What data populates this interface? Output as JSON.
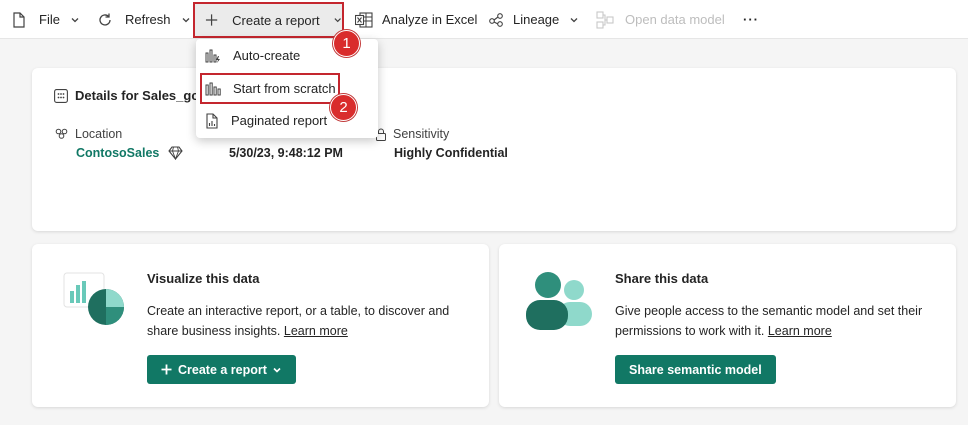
{
  "toolbar": {
    "file_label": "File",
    "refresh_label": "Refresh",
    "create_report_label": "Create a report",
    "analyze_excel_label": "Analyze in Excel",
    "lineage_label": "Lineage",
    "open_data_model_label": "Open data model",
    "more_label": "···"
  },
  "dropdown": {
    "items": [
      {
        "label": "Auto-create",
        "icon": "auto-create-icon"
      },
      {
        "label": "Start from scratch",
        "icon": "bar-chart-icon"
      },
      {
        "label": "Paginated report",
        "icon": "paginated-report-icon"
      }
    ]
  },
  "callouts": {
    "one": "1",
    "two": "2"
  },
  "details": {
    "title": "Details for Sales_gc",
    "location_label": "Location",
    "location_value": "ContosoSales",
    "refreshed_value": "5/30/23, 9:48:12 PM",
    "sensitivity_label": "Sensitivity",
    "sensitivity_value": "Highly Confidential"
  },
  "visualize": {
    "title": "Visualize this data",
    "desc_line1": "Create an interactive report, or a table, to discover and",
    "desc_line2_text": "share business insights.",
    "learn_more": "Learn more",
    "button_label": "Create a report"
  },
  "share": {
    "title": "Share this data",
    "desc_line1": "Give people access to the semantic model and set their",
    "desc_line2_text": "permissions to work with it.",
    "learn_more": "Learn more",
    "button_label": "Share semantic model"
  },
  "colors": {
    "accent": "#117865",
    "callout": "#d92c2c",
    "highlight_border": "#c4262e"
  }
}
